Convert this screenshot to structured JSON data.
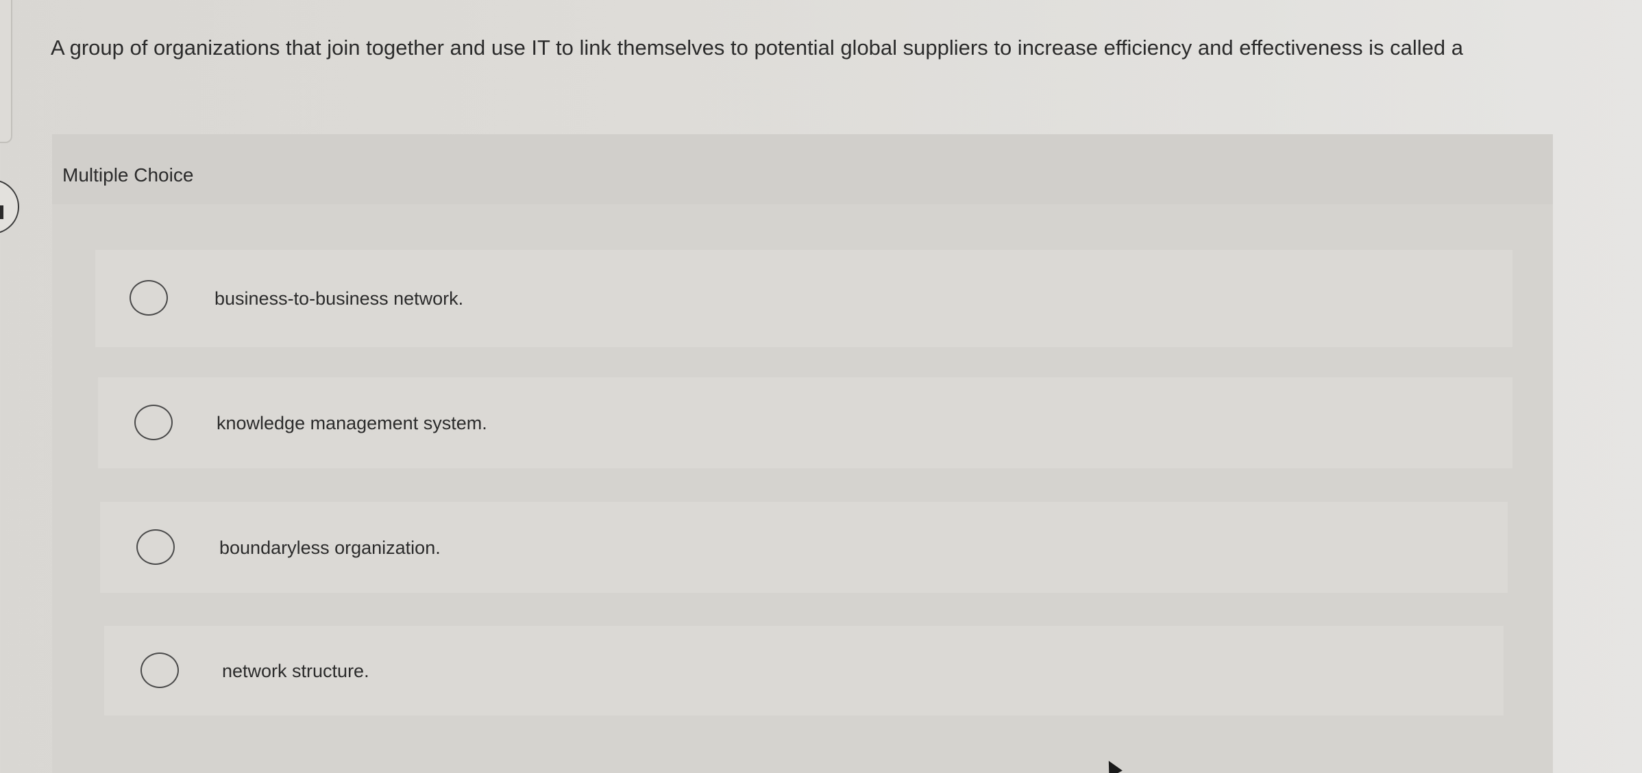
{
  "question": {
    "text": "A group of organizations that join together and use IT to link themselves to potential global suppliers to increase efficiency and effectiveness is called a"
  },
  "panel": {
    "title": "Multiple Choice"
  },
  "options": [
    {
      "label": "business-to-business network."
    },
    {
      "label": "knowledge management system."
    },
    {
      "label": "boundaryless organization."
    },
    {
      "label": "network structure."
    }
  ],
  "colors": {
    "background": "#dedcd8",
    "panel": "#d5d3cf",
    "option": "#dbd9d5",
    "text": "#2b2b2b",
    "radio_border": "#4a4a4a"
  },
  "icons": {
    "radio": "radio-unchecked-icon",
    "cursor": "mouse-pointer-icon"
  }
}
